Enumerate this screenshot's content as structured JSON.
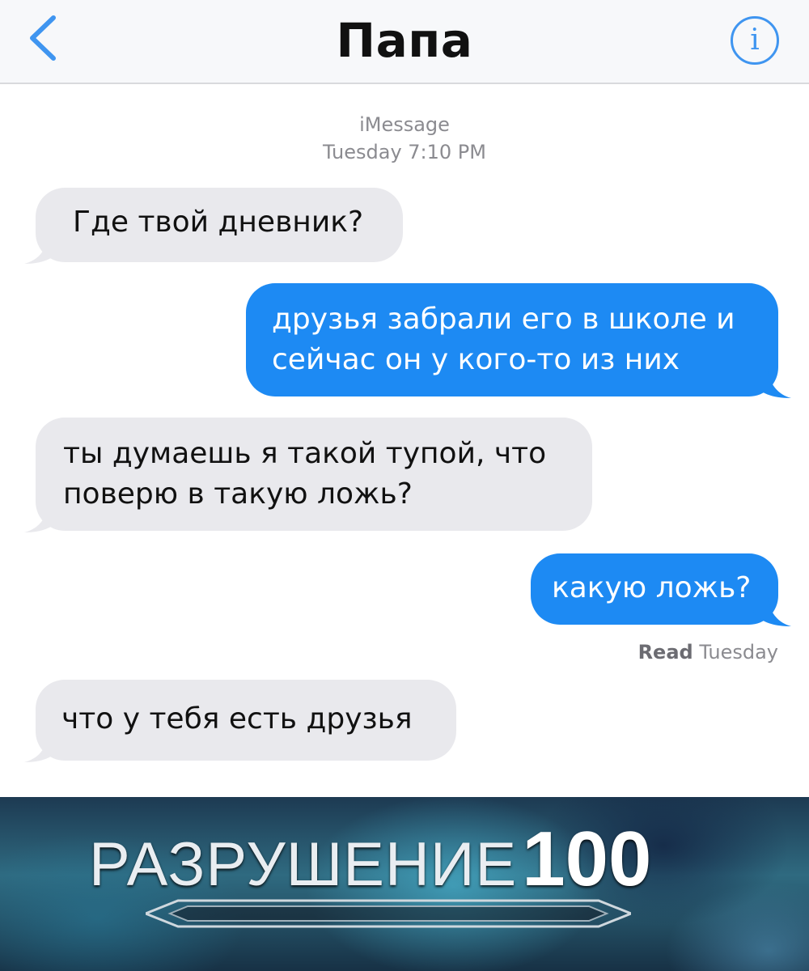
{
  "header": {
    "back_icon": "chevron-left-icon",
    "title": "Папа",
    "info_icon": "info-icon",
    "info_glyph": "i",
    "accent_color": "#3f95f0"
  },
  "conversation": {
    "service": "iMessage",
    "timestamp": "Tuesday 7:10 PM",
    "messages": [
      {
        "direction": "incoming",
        "lines": [
          "Где твой дневник?"
        ]
      },
      {
        "direction": "outgoing",
        "lines": [
          "друзья забрали его в школе и",
          "сейчас он у кого-то из них"
        ]
      },
      {
        "direction": "incoming",
        "lines": [
          "ты думаешь я такой тупой, что",
          "поверю в такую ложь?"
        ]
      },
      {
        "direction": "outgoing",
        "lines": [
          "какую ложь?"
        ]
      },
      {
        "direction": "incoming",
        "lines": [
          "что у тебя есть друзья"
        ]
      }
    ],
    "read_receipt": {
      "label": "Read",
      "day": "Tuesday"
    },
    "incoming_color": "#e9e9ed",
    "outgoing_color": "#1d8af3"
  },
  "banner": {
    "word": "РАЗРУШЕНИЕ",
    "level": "100"
  }
}
